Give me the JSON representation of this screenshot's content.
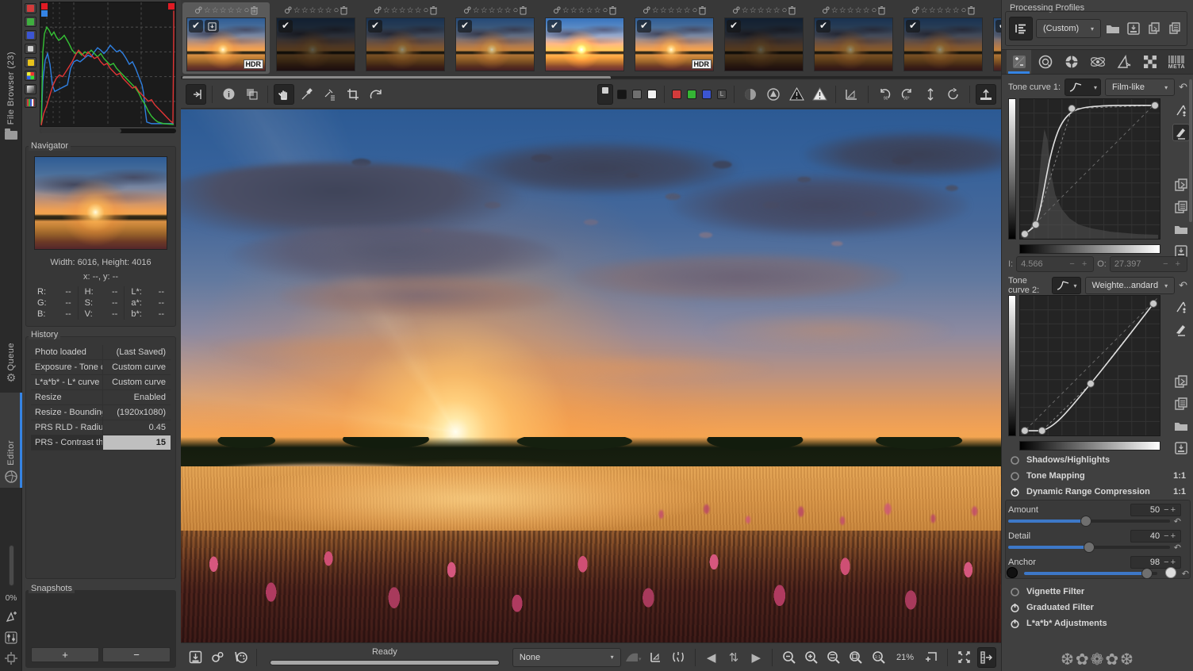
{
  "glyphs": {
    "check": "✔",
    "stars": "☆☆☆☆☆",
    "circle": "○",
    "gear": "⚙",
    "minus": "−",
    "plus": "+",
    "dd_arrow": "▾",
    "reset": "↶",
    "prev": "◀",
    "next": "▶",
    "updown": "⇅",
    "warn": "⚠",
    "expand": "⤢",
    "flowers_deco": "❆✿❁✿❆"
  },
  "left_rail": {
    "file_browser": "File Browser (23)",
    "queue": "Queue",
    "editor": "Editor",
    "zoom_value": "0%"
  },
  "navigator": {
    "title": "Navigator",
    "size_line": "Width: 6016, Height: 4016",
    "xy_line": "x: --, y: --",
    "cells": [
      {
        "k": "R:",
        "v": "--"
      },
      {
        "k": "H:",
        "v": "--"
      },
      {
        "k": "L*:",
        "v": "--"
      },
      {
        "k": "G:",
        "v": "--"
      },
      {
        "k": "S:",
        "v": "--"
      },
      {
        "k": "a*:",
        "v": "--"
      },
      {
        "k": "B:",
        "v": "--"
      },
      {
        "k": "V:",
        "v": "--"
      },
      {
        "k": "b*:",
        "v": "--"
      }
    ]
  },
  "history": {
    "title": "History",
    "items": [
      {
        "name": "Photo loaded",
        "value": "(Last Saved)"
      },
      {
        "name": "Exposure - Tone c...",
        "value": "Custom curve"
      },
      {
        "name": "L*a*b* - L* curve",
        "value": "Custom curve"
      },
      {
        "name": "Resize",
        "value": "Enabled"
      },
      {
        "name": "Resize - Bounding...",
        "value": "(1920x1080)"
      },
      {
        "name": "PRS RLD - Radius",
        "value": "0.45"
      },
      {
        "name": "PRS - Contrast thr...",
        "value": "15"
      }
    ]
  },
  "snapshots": {
    "title": "Snapshots",
    "add": "+",
    "remove": "−"
  },
  "filmstrip": {
    "hdr_badge": "HDR"
  },
  "statusbar": {
    "ready": "Ready",
    "profile_value": "None",
    "zoom_value": "21%"
  },
  "right_panel": {
    "profiles_title": "Processing Profiles",
    "profile_value": "(Custom)",
    "meta_tab": "META",
    "tone_curve_1": {
      "label": "Tone curve 1:",
      "mode": "Film-like",
      "i_label": "I:",
      "i_value": "4.566",
      "o_label": "O:",
      "o_value": "27.397"
    },
    "tone_curve_2": {
      "label": "Tone curve 2:",
      "mode": "Weighte...andard"
    },
    "sections": [
      {
        "label": "Shadows/Highlights",
        "badge": ""
      },
      {
        "label": "Tone Mapping",
        "badge": "1:1"
      },
      {
        "label": "Dynamic Range Compression",
        "badge": "1:1"
      }
    ],
    "sliders": [
      {
        "label": "Amount",
        "value": "50",
        "pct": 48
      },
      {
        "label": "Detail",
        "value": "40",
        "pct": 50
      },
      {
        "label": "Anchor",
        "value": "98",
        "pct": 92
      }
    ],
    "sections_bottom": [
      {
        "label": "Vignette Filter"
      },
      {
        "label": "Graduated Filter"
      },
      {
        "label": "L*a*b* Adjustments"
      }
    ]
  }
}
